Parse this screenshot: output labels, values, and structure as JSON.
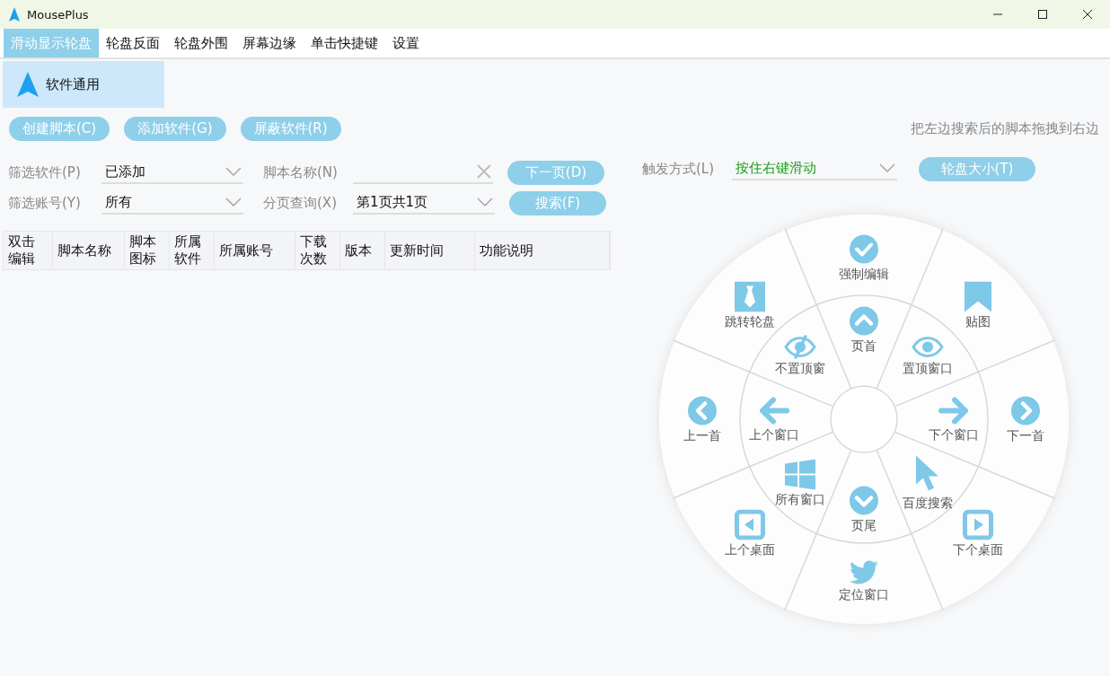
{
  "window": {
    "title": "MousePlus"
  },
  "tabs": [
    {
      "label": "滑动显示轮盘",
      "selected": true
    },
    {
      "label": "轮盘反面",
      "selected": false
    },
    {
      "label": "轮盘外围",
      "selected": false
    },
    {
      "label": "屏幕边缘",
      "selected": false
    },
    {
      "label": "单击快捷键",
      "selected": false
    },
    {
      "label": "设置",
      "selected": false
    }
  ],
  "sidebar": {
    "items": [
      {
        "label": "软件通用",
        "selected": true
      }
    ]
  },
  "actions": [
    "创建脚本(C)",
    "添加软件(G)",
    "屏蔽软件(R)"
  ],
  "hint": "把左边搜索后的脚本拖拽到右边",
  "filters": {
    "software": {
      "label": "筛选软件(P)",
      "value": "已添加"
    },
    "account": {
      "label": "筛选账号(Y)",
      "value": "所有"
    },
    "script_name": {
      "label": "脚本名称(N)"
    },
    "page": {
      "label": "分页查询(X)",
      "value": "第1页共1页"
    }
  },
  "next_button": "下一页(D)",
  "search_button": "搜索(F)",
  "table": {
    "columns": [
      "双击编辑",
      "脚本名称",
      "脚本图标",
      "所属软件",
      "所属账号",
      "下载次数",
      "版本",
      "更新时间",
      "功能说明"
    ]
  },
  "trigger": {
    "label": "触发方式(L)",
    "value": "按住右键滑动"
  },
  "wheel_size_button": "轮盘大小(T)",
  "wheel": {
    "outer_items": [
      "强制编辑",
      "贴图",
      "下一首",
      "下个桌面",
      "定位窗口",
      "上个桌面",
      "上一首",
      "跳转轮盘"
    ],
    "inner_items": [
      "页首",
      "置顶窗口",
      "下个窗口",
      "百度搜索",
      "页尾",
      "所有窗口",
      "上个窗口",
      "不置顶窗"
    ]
  }
}
